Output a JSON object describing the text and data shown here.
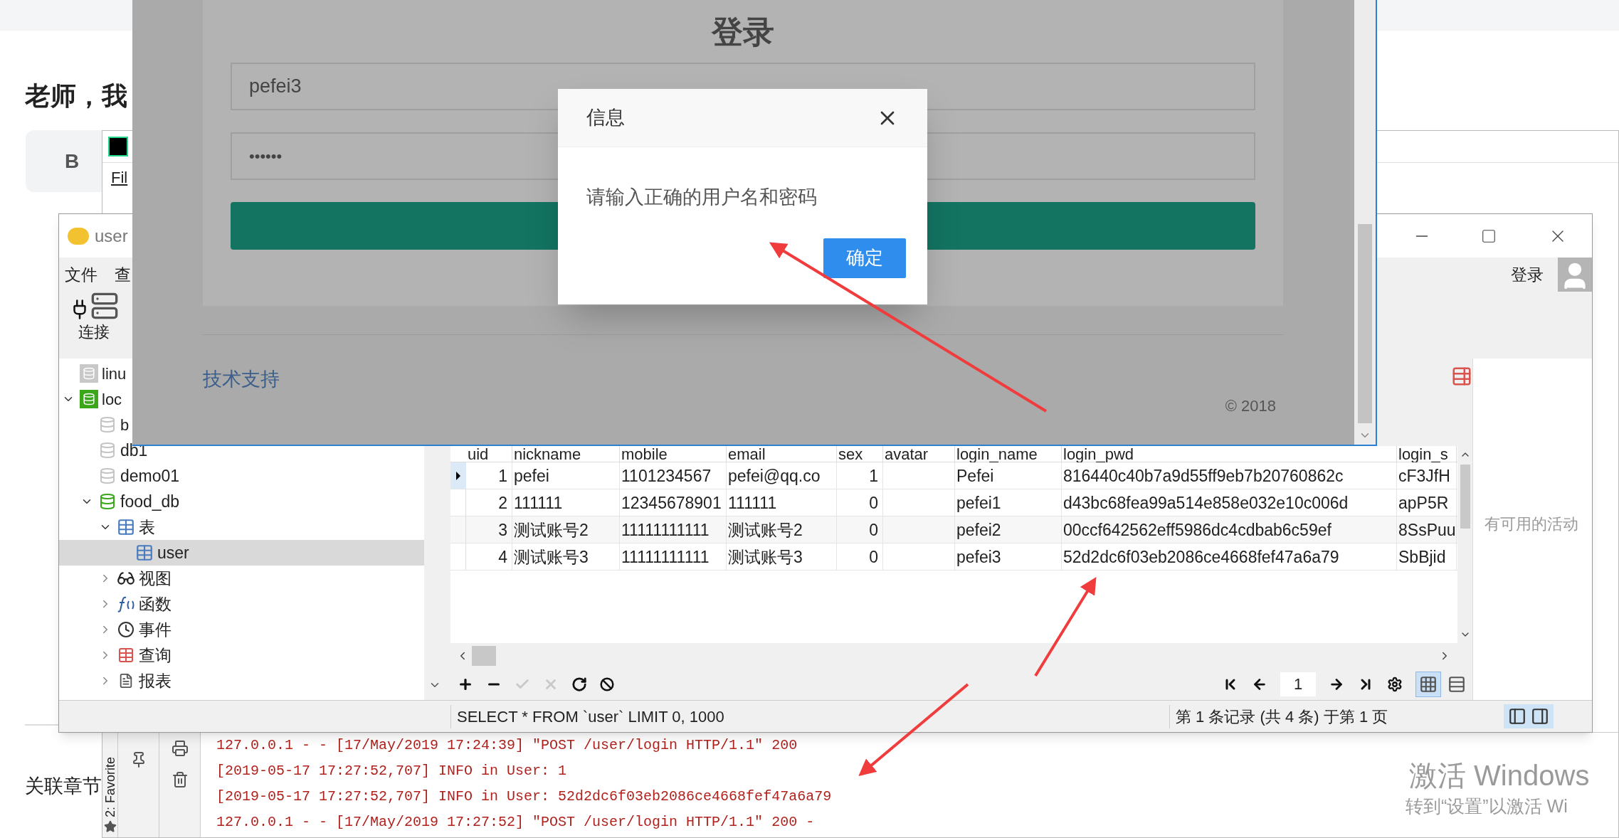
{
  "background_page": {
    "heading": "老师，我",
    "toolbar_button": "B",
    "section_label": "关联章节"
  },
  "pycharm": {
    "menu": [
      "Fil"
    ],
    "side_tab": "2: Favorite",
    "console_lines": [
      "127.0.0.1 - - [17/May/2019 17:24:39] \"POST /user/login HTTP/1.1\" 200",
      "[2019-05-17 17:27:52,707] INFO in User: 1",
      "[2019-05-17 17:27:52,707] INFO in User: 52d2dc6f03eb2086ce4668fef47a6a79",
      "127.0.0.1 - - [17/May/2019 17:27:52] \"POST /user/login HTTP/1.1\" 200 -"
    ]
  },
  "navicat": {
    "title": "user",
    "menu": [
      "文件",
      "查"
    ],
    "toolbar": [
      "连接"
    ],
    "login_button": "登录",
    "side_text": "有可用的活动",
    "tree": [
      {
        "label": "linu",
        "kind": "connection",
        "open": false,
        "selected": false
      },
      {
        "label": "loc",
        "kind": "connection",
        "open": true,
        "expanded": true,
        "selected": false,
        "children": [
          {
            "label": "b",
            "kind": "database",
            "open": false,
            "selected": false
          },
          {
            "label": "db1",
            "kind": "database",
            "open": false,
            "selected": false
          },
          {
            "label": "demo01",
            "kind": "database",
            "open": false,
            "selected": false
          },
          {
            "label": "food_db",
            "kind": "database",
            "open": true,
            "expanded": true,
            "selected": false,
            "children": [
              {
                "label": "表",
                "kind": "tables",
                "expanded": true,
                "selected": false,
                "children": [
                  {
                    "label": "user",
                    "kind": "table",
                    "selected": true
                  }
                ]
              },
              {
                "label": "视图",
                "kind": "views",
                "expanded": false,
                "selected": false
              },
              {
                "label": "函数",
                "kind": "functions",
                "expanded": false,
                "selected": false
              },
              {
                "label": "事件",
                "kind": "events",
                "expanded": false,
                "selected": false
              },
              {
                "label": "查询",
                "kind": "queries",
                "expanded": false,
                "selected": false
              },
              {
                "label": "报表",
                "kind": "reports",
                "expanded": false,
                "selected": false
              }
            ]
          }
        ]
      }
    ],
    "table": {
      "columns": [
        {
          "label": "uid",
          "kind": "number"
        },
        {
          "label": "nickname",
          "kind": "text"
        },
        {
          "label": "mobile",
          "kind": "text"
        },
        {
          "label": "email",
          "kind": "text"
        },
        {
          "label": "sex",
          "kind": "number"
        },
        {
          "label": "avatar",
          "kind": "text"
        },
        {
          "label": "login_name",
          "kind": "text"
        },
        {
          "label": "login_pwd",
          "kind": "text"
        },
        {
          "label": "login_s",
          "kind": "text"
        }
      ],
      "rows": [
        {
          "selected": true,
          "cells": [
            "1",
            "pefei",
            "1101234567",
            "pefei@qq.co",
            "1",
            "",
            "Pefei",
            "816440c40b7a9d55ff9eb7b20760862c",
            "cF3JfH"
          ]
        },
        {
          "selected": false,
          "cells": [
            "2",
            "111111",
            "12345678901",
            "111111",
            "0",
            "",
            "pefei1",
            "d43bc68fea99a514e858e032e10c006d",
            "apP5R"
          ]
        },
        {
          "selected": false,
          "cells": [
            "3",
            "测试账号2",
            "11111111111",
            "测试账号2",
            "0",
            "",
            "pefei2",
            "00ccf642562eff5986dc4cdbab6c59ef",
            "8SsPuu"
          ]
        },
        {
          "selected": false,
          "cells": [
            "4",
            "测试账号3",
            "11111111111",
            "测试账号3",
            "0",
            "",
            "pefei3",
            "52d2dc6f03eb2086ce4668fef47a6a79",
            "SbBjid"
          ]
        }
      ]
    },
    "page_field": "1",
    "view_buttons": [
      {
        "kind": "grid",
        "selected": true
      },
      {
        "kind": "form",
        "selected": false
      }
    ],
    "status_bar": {
      "query": "SELECT * FROM `user` LIMIT 0, 1000",
      "records": "第 1 条记录 (共 4 条) 于第 1 页"
    }
  },
  "browser": {
    "title": "登录",
    "username": "pefei3",
    "password": "••••••",
    "support_link": "技术支持",
    "copyright": "© 2018"
  },
  "dialog": {
    "title": "信息",
    "message": "请输入正确的用户名和密码",
    "ok_button": "确定"
  },
  "activation_notice": {
    "title": "激活 Windows",
    "subtitle": "转到“设置”以激活 Wi"
  }
}
